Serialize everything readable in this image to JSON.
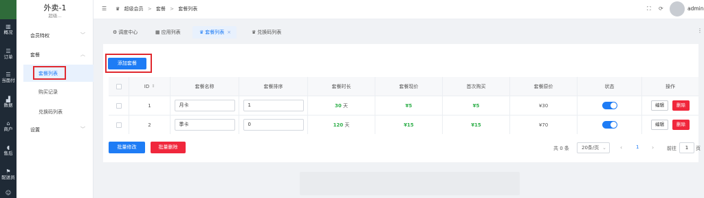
{
  "rail": {
    "items": [
      {
        "icon": "▥",
        "label": "概况"
      },
      {
        "icon": "☰",
        "label": "订单"
      },
      {
        "icon": "☰",
        "label": "当面付"
      },
      {
        "icon": "▟",
        "label": "数据"
      },
      {
        "icon": "⌂",
        "label": "商户"
      },
      {
        "icon": "◖",
        "label": "售后"
      },
      {
        "icon": "⚑",
        "label": "配送员"
      },
      {
        "icon": "☺",
        "label": ""
      }
    ]
  },
  "sidebar": {
    "title": "外卖-1",
    "subtitle": "超级...",
    "groups": [
      {
        "label": "会员特权",
        "arrow": "﹀"
      },
      {
        "label": "套餐",
        "arrow": "︿"
      },
      {
        "label": "设置",
        "arrow": "﹀"
      }
    ],
    "items": [
      {
        "label": "套餐列表"
      },
      {
        "label": "购买记录"
      },
      {
        "label": "兑换码列表"
      }
    ]
  },
  "header": {
    "collapse_icon": "☰",
    "breadcrumb": [
      "超级会员",
      ">",
      "套餐",
      ">",
      "套餐列表"
    ],
    "admin_name": "admin"
  },
  "tabs": [
    {
      "icon": "⚙",
      "label": "调度中心"
    },
    {
      "icon": "▦",
      "label": "应用列表"
    },
    {
      "icon": "♛",
      "label": "套餐列表",
      "close": "×"
    },
    {
      "icon": "♛",
      "label": "兑换码列表"
    }
  ],
  "toolbar": {
    "add_label": "添加套餐",
    "batch_edit_label": "批量修改",
    "batch_delete_label": "批量删除"
  },
  "table": {
    "columns": [
      "ID",
      "套餐名称",
      "套餐排序",
      "套餐时长",
      "套餐现价",
      "首次购买",
      "套餐原价",
      "状态",
      "操作"
    ],
    "rows": [
      {
        "id": "1",
        "name": "月卡",
        "sort": "1",
        "duration_num": "30",
        "duration_unit": "天",
        "price_now": "¥5",
        "first_buy": "¥5",
        "price_orig": "¥30",
        "status": true,
        "edit": "编辑",
        "del": "删除"
      },
      {
        "id": "2",
        "name": "季卡",
        "sort": "0",
        "duration_num": "120",
        "duration_unit": "天",
        "price_now": "¥15",
        "first_buy": "¥15",
        "price_orig": "¥70",
        "status": true,
        "edit": "编辑",
        "del": "删除"
      }
    ]
  },
  "pagination": {
    "total": "共 0 条",
    "page_size": "20条/页",
    "current_page": "1",
    "goto_label": "前往",
    "goto_value": "1",
    "goto_unit": "页"
  },
  "colors": {
    "primary": "#1e7cf5",
    "danger": "#f0273c",
    "price_green": "#2faf4a",
    "highlight_red": "#e0282e"
  }
}
